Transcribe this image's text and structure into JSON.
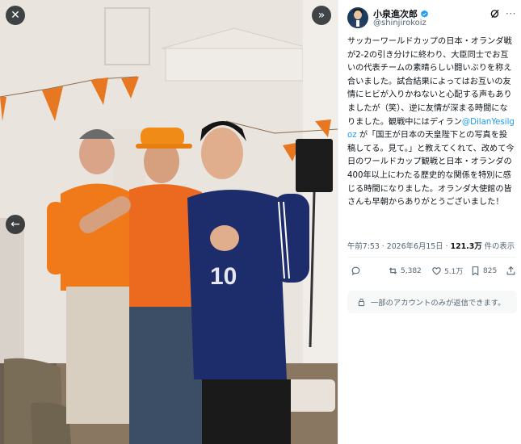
{
  "photo": {
    "alt_description": "",
    "close_icon": "close-icon",
    "expand_icon": "expand-icon",
    "prev_icon": "chevron-left-icon"
  },
  "post": {
    "author": {
      "name": "小泉進次郎",
      "handle": "@shinjirokoiz",
      "verified_color": "#1d9bf0"
    },
    "text_segments": [
      {
        "type": "text",
        "value": "サッカーワールドカップの日本・オランダ戦が2-2の引き分けに終わり、大臣同士でお互いの代表チームの素晴らしい闘いぶりを称え合いました。試合結果によってはお互いの友情にヒビが入りかねないと心配する声もありましたが（笑）、逆に友情が深まる時間になりました。観戦中にはディラン"
      },
      {
        "type": "mention",
        "value": "@DilanYesilgoz"
      },
      {
        "type": "text",
        "value": " が「国王が日本の天皇陛下との写真を投稿してる。見て。」と教えてくれて、改めて今日のワールドカップ観戦と日本・オランダの400年以上にわたる歴史的な関係を特別に感じる時間になりました。オランダ大使館の皆さんも早朝からありがとうございました！"
      }
    ],
    "timestamp": "午前7:53 · 2026年6月15日 · ",
    "views_count": "121.3万",
    "views_label": " 件の表示",
    "actions": {
      "reply_count": "",
      "repost_count": "5,382",
      "like_count": "5.1万",
      "bookmark_count": "825"
    },
    "reply_notice": "一部のアカウントのみが返信できます。",
    "accent_color": "#1d9bf0"
  }
}
